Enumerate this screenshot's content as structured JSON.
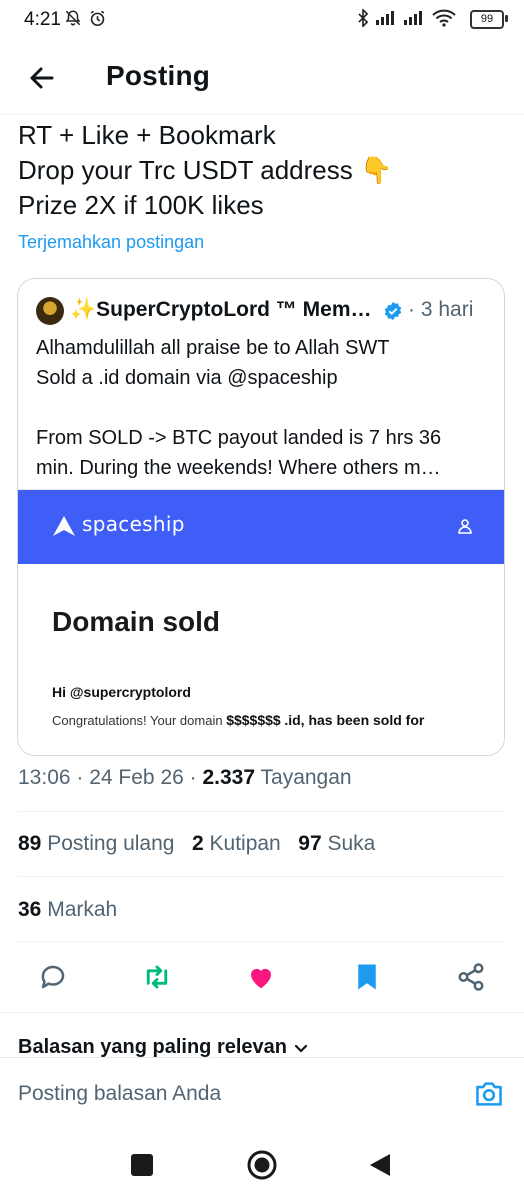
{
  "status_bar": {
    "time": "4:21",
    "battery": "99"
  },
  "header": {
    "title": "Posting"
  },
  "post": {
    "lines": [
      "RT + Like + Bookmark",
      "Drop your Trc USDT address 👇",
      "Prize 2X if 100K likes"
    ],
    "translate": "Terjemahkan postingan"
  },
  "quote": {
    "name": "✨SuperCryptoLord ™ Mem…",
    "time": "· 3 hari",
    "lines": [
      "Alhamdulillah all praise be to Allah SWT",
      "Sold a .id domain via @spaceship",
      "",
      "From SOLD -> BTC payout landed is 7 hrs 36",
      "min. During the weekends! Where others m…"
    ],
    "image": {
      "brand": "spaceship",
      "heading": "Domain sold",
      "hi": "Hi",
      "handle": "@supercryptolord",
      "congrats_prefix": "Congratulations! Your domain",
      "domain_masked": "$$$$$$$",
      "congrats_suffix": ".id, has been sold for"
    }
  },
  "meta": {
    "time": "13:06",
    "date": "24 Feb 26",
    "views": "2.337",
    "views_label": "Tayangan"
  },
  "stats": {
    "reposts": "89",
    "reposts_label": "Posting ulang",
    "quotes": "2",
    "quotes_label": "Kutipan",
    "likes": "97",
    "likes_label": "Suka",
    "bookmarks": "36",
    "bookmarks_label": "Markah"
  },
  "replies": {
    "sort_label": "Balasan yang paling relevan",
    "placeholder": "Posting balasan Anda"
  },
  "colors": {
    "accent": "#1d9bf0",
    "retweet": "#00ba7c",
    "like": "#f91880",
    "spaceship": "#3f5ef8"
  }
}
